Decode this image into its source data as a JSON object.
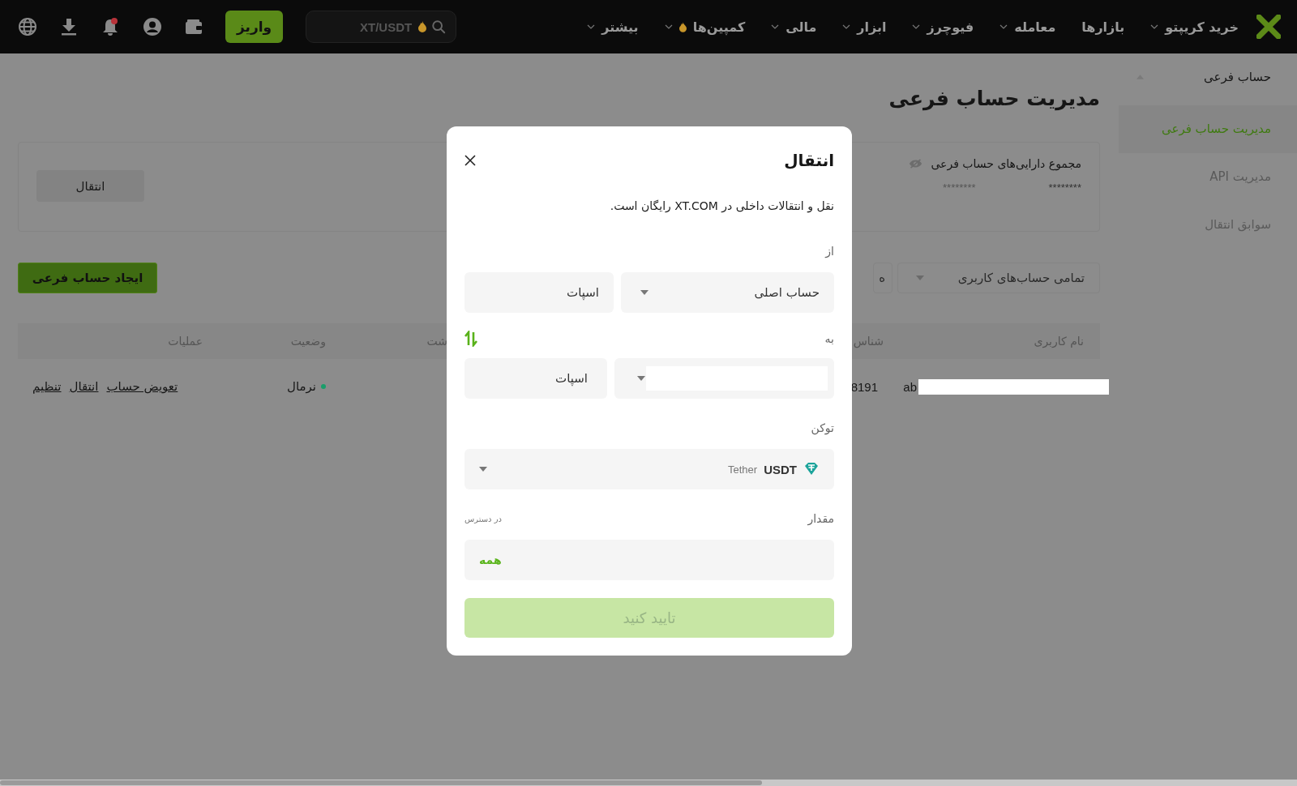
{
  "nav": {
    "items": [
      {
        "label": "خرید کریپتو",
        "dropdown": true,
        "hot": false
      },
      {
        "label": "بازارها",
        "dropdown": false,
        "hot": false
      },
      {
        "label": "معامله",
        "dropdown": true,
        "hot": false
      },
      {
        "label": "فیوچرز",
        "dropdown": true,
        "hot": false
      },
      {
        "label": "ابزار",
        "dropdown": true,
        "hot": false
      },
      {
        "label": "مالی",
        "dropdown": true,
        "hot": false
      },
      {
        "label": "کمپین‌ها",
        "dropdown": true,
        "hot": true
      },
      {
        "label": "بیشتر",
        "dropdown": true,
        "hot": false
      }
    ],
    "search": {
      "placeholder": "XT/USDT"
    },
    "deposit_button": "واریز",
    "notifications_unread": true
  },
  "sidebar": {
    "group": {
      "label": "حساب فرعی",
      "expanded": true
    },
    "items": [
      {
        "label": "مدیریت حساب فرعی",
        "selected": true
      },
      {
        "label": "مدیریت API",
        "selected": false
      },
      {
        "label": "سوابق انتقال",
        "selected": false
      }
    ]
  },
  "page_title": "مدیریت حساب فرعی",
  "summary": {
    "title": "مجموع دارایی‌های حساب فرعی",
    "values": [
      "********",
      "********"
    ],
    "transfer_button": "انتقال"
  },
  "filters": [
    {
      "label": "تمامی حساب‌های کاربری",
      "dropdown": true
    },
    {
      "label": "ه"
    }
  ],
  "create_button": "ایجاد حساب فرعی",
  "table": {
    "columns": [
      "نام کاربری",
      "شناس",
      "شت",
      "وضعیت",
      "عملیات"
    ],
    "rows": [
      {
        "username": "ab",
        "id": "8191",
        "status": {
          "label": "نرمال",
          "color": "#1a9e6a"
        },
        "actions": [
          "تعویض حساب",
          "انتقال",
          "تنظیم"
        ]
      }
    ]
  },
  "modal": {
    "title": "انتقال",
    "description": "نقل و انتقالات داخلی در XT.COM رایگان است.",
    "from": {
      "label": "از",
      "account": "حساب اصلی",
      "wallet": "اسپات"
    },
    "to": {
      "label": "به",
      "wallet": "اسپات"
    },
    "token": {
      "label": "توکن",
      "symbol": "USDT",
      "name": "Tether"
    },
    "amount": {
      "label": "مقدار",
      "available_label": "در دسترس",
      "all_button": "همه"
    },
    "confirm": {
      "label": "تایید کنید",
      "disabled": true
    }
  }
}
